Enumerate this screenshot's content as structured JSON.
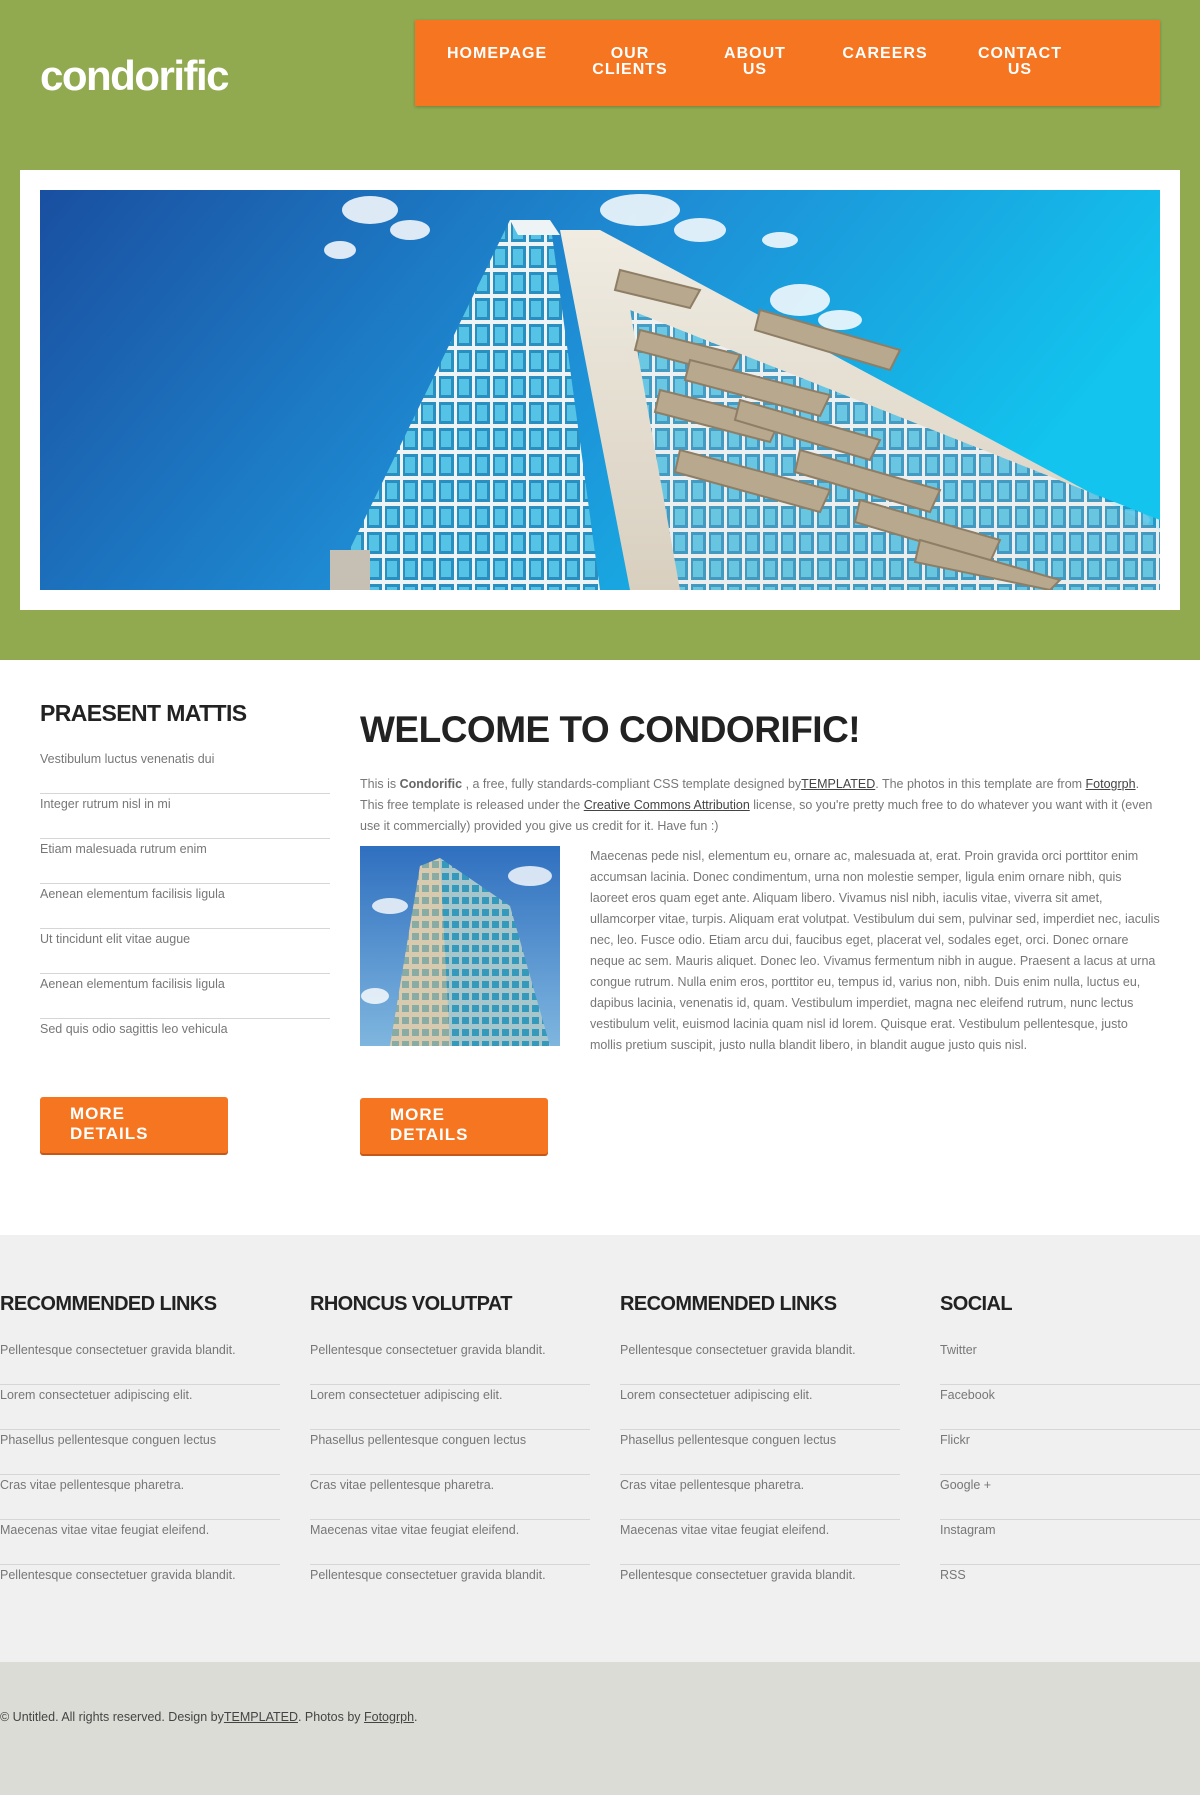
{
  "header": {
    "logo": "condorific",
    "nav": [
      {
        "line1": "HOMEPAGE",
        "line2": ""
      },
      {
        "line1": "OUR",
        "line2": "CLIENTS"
      },
      {
        "line1": "ABOUT",
        "line2": "US"
      },
      {
        "line1": "CAREERS",
        "line2": ""
      },
      {
        "line1": "CONTACT",
        "line2": "US"
      }
    ]
  },
  "sidebar": {
    "title": "PRAESENT MATTIS",
    "items": [
      "Vestibulum luctus venenatis dui",
      "Integer rutrum nisl in mi",
      "Etiam malesuada rutrum enim",
      "Aenean elementum facilisis ligula",
      "Ut tincidunt elit vitae augue",
      "Aenean elementum facilisis ligula",
      "Sed quis odio sagittis leo vehicula"
    ],
    "button": {
      "line1": "MORE",
      "line2": "DETAILS"
    }
  },
  "main": {
    "title": "WELCOME TO CONDORIFIC!",
    "intro": {
      "p1": "This is ",
      "brand": "Condorific",
      "p2": " , a free, fully standards-compliant CSS template designed by",
      "link1": "TEMPLATED",
      "p3": ". The photos in this template are from ",
      "link2": "Fotogrph",
      "p4": ". This free template is released under the ",
      "link3": "Creative Commons Attribution",
      "p5": " license, so you're pretty much free to do whatever you want with it (even use it commercially) provided you give us credit for it. Have fun :)"
    },
    "body": "Maecenas pede nisl, elementum eu, ornare ac, malesuada at, erat. Proin gravida orci porttitor enim accumsan lacinia. Donec condimentum, urna non molestie semper, ligula enim ornare nibh, quis laoreet eros quam eget ante. Aliquam libero. Vivamus nisl nibh, iaculis vitae, viverra sit amet, ullamcorper vitae, turpis. Aliquam erat volutpat. Vestibulum dui sem, pulvinar sed, imperdiet nec, iaculis nec, leo. Fusce odio. Etiam arcu dui, faucibus eget, placerat vel, sodales eget, orci. Donec ornare neque ac sem. Mauris aliquet. Donec leo. Vivamus fermentum nibh in augue. Praesent a lacus at urna congue rutrum. Nulla enim eros, porttitor eu, tempus id, varius non, nibh. Duis enim nulla, luctus eu, dapibus lacinia, venenatis id, quam. Vestibulum imperdiet, magna nec eleifend rutrum, nunc lectus vestibulum velit, euismod lacinia quam nisl id lorem. Quisque erat. Vestibulum pellentesque, justo mollis pretium suscipit, justo nulla blandit libero, in blandit augue justo quis nisl.",
    "button": {
      "line1": "MORE",
      "line2": "DETAILS"
    }
  },
  "footer": {
    "columns": [
      {
        "title": "RECOMMENDED LINKS",
        "items": [
          "Pellentesque consectetuer gravida blandit.",
          "Lorem consectetuer adipiscing elit.",
          "Phasellus pellentesque conguen lectus",
          "Cras vitae pellentesque pharetra.",
          "Maecenas vitae vitae feugiat eleifend.",
          "Pellentesque consectetuer gravida blandit."
        ]
      },
      {
        "title": "RHONCUS VOLUTPAT",
        "items": [
          "Pellentesque consectetuer gravida blandit.",
          "Lorem consectetuer adipiscing elit.",
          "Phasellus pellentesque conguen lectus",
          "Cras vitae pellentesque pharetra.",
          "Maecenas vitae vitae feugiat eleifend.",
          "Pellentesque consectetuer gravida blandit."
        ]
      },
      {
        "title": "RECOMMENDED LINKS",
        "items": [
          "Pellentesque consectetuer gravida blandit.",
          "Lorem consectetuer adipiscing elit.",
          "Phasellus pellentesque conguen lectus",
          "Cras vitae pellentesque pharetra.",
          "Maecenas vitae vitae feugiat eleifend.",
          "Pellentesque consectetuer gravida blandit."
        ]
      },
      {
        "title": "SOCIAL",
        "items": [
          "Twitter",
          "Facebook",
          "Flickr",
          "Google +",
          "Instagram",
          "RSS"
        ]
      }
    ],
    "copyright": {
      "p1": "© Untitled. All rights reserved. Design by",
      "link1": "TEMPLATED",
      "p2": ". Photos by ",
      "link2": "Fotogrph",
      "p3": "."
    }
  },
  "colors": {
    "header_green": "#91aa50",
    "accent_orange": "#f57521",
    "footer_gray": "#f0f0f0",
    "copyright_gray": "#dcdcd6"
  }
}
